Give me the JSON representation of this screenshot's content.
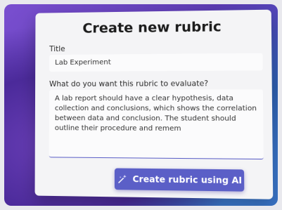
{
  "modal": {
    "title": "Create new rubric",
    "title_field_label": "Title",
    "title_value": "Lab Experiment",
    "evaluate_label": "What do you want this rubric to evaluate?",
    "evaluate_value": "A lab report should have a clear hypothesis, data collection and conclusions, which shows the correlation between data and conclusion. The student should outline their procedure and remem",
    "primary_button_label": "Create rubric using AI",
    "primary_button_icon": "sparkle-icon"
  },
  "colors": {
    "accent": "#5b5fc7",
    "background_purple": "#5b3bb2",
    "background_blue": "#3b5fd0"
  }
}
